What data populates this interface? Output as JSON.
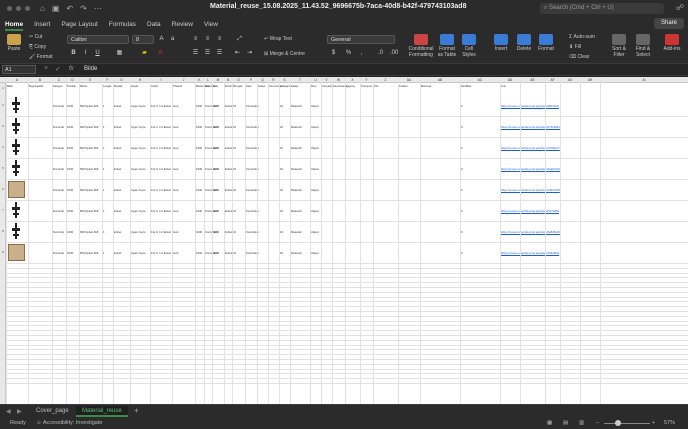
{
  "window": {
    "title": "Material_reuse_15.08.2025_11.43.52_9696675b-7aca-40d8-b42f-479743103ad8",
    "search_placeholder": "Search (Cmd + Ctrl + U)"
  },
  "tabs": [
    "Home",
    "Insert",
    "Page Layout",
    "Formulas",
    "Data",
    "Review",
    "View"
  ],
  "share_label": "Share",
  "ribbon": {
    "paste": "Paste",
    "cut": "Cut",
    "copy": "Copy",
    "format": "Format",
    "font_name": "Calibri",
    "font_size": "8",
    "wrap_text": "Wrap Text",
    "merge_centre": "Merge & Centre",
    "number_format": "General",
    "conditional_formatting": "Conditional Formatting",
    "format_as_table": "Format as Table",
    "cell_styles": "Cell Styles",
    "insert": "Insert",
    "delete": "Delete",
    "format_cells": "Format",
    "autosum": "Auto-sum",
    "fill": "Fill",
    "clear": "Clear",
    "sort_filter": "Sort & Filter",
    "find_select": "Find & Select",
    "add_ins": "Add-ins"
  },
  "formula_bar": {
    "cell_ref": "A1",
    "fx": "fx",
    "value": "Bilde"
  },
  "columns": [
    "A",
    "B",
    "C",
    "D",
    "E",
    "F",
    "G",
    "H",
    "I",
    "J",
    "K",
    "L",
    "M",
    "N",
    "O",
    "P",
    "Q",
    "R",
    "S",
    "T",
    "U",
    "V",
    "W",
    "X",
    "Y",
    "Z",
    "AA",
    "AB",
    "AC",
    "AD",
    "AE",
    "AF",
    "AG",
    "AH",
    "AI"
  ],
  "headers": [
    "Bilde",
    "Bygningsdel",
    "Kategori",
    "Produkt",
    "Merke",
    "Lengde",
    "Bredde",
    "Hoyde",
    "Antall",
    "Tilstand",
    "Beskrivelse",
    "Materiale",
    "Vekt",
    "Enhet",
    "Mengde",
    "Dato",
    "Status",
    "Kommentar",
    "Lokasjon",
    "Etasje",
    "Rom",
    "Ansvarlig",
    "Demontering",
    "Lagring",
    "Transport",
    "Pris",
    "Kvalitet",
    "Merknad",
    "Sertifikat",
    "Link"
  ],
  "rows": [
    {
      "num": "2",
      "has_part": true,
      "cells": [
        "",
        "",
        "Dorvindu",
        "1000",
        "MM Spleis 8x8",
        "1",
        "Enhet",
        "Ingen hoyre",
        "Fra 0, 1.0 Enkel",
        "God",
        "1000",
        "Kontrollert",
        "1000",
        "Enhet",
        "10",
        "Kontrollert",
        "",
        "",
        "10",
        "Materiell",
        "Ukjent",
        "",
        "",
        "",
        "",
        "",
        "",
        "",
        "0",
        "https://reuse-materials-prod.app/item/a8b3f1c0"
      ]
    },
    {
      "num": "3",
      "has_part": true,
      "cells": [
        "",
        "",
        "Dorvindu",
        "1000",
        "MM Spleis 8x8",
        "1",
        "Enhet",
        "Ingen hoyre",
        "Fra 0, 1.0 Enkel",
        "God",
        "1000",
        "Kontrollert",
        "1000",
        "Enhet",
        "10",
        "Kontrollert",
        "",
        "",
        "10",
        "Materiell",
        "Ukjent",
        "",
        "",
        "",
        "",
        "",
        "",
        "",
        "0",
        "https://reuse-materials-prod.app/item/b72e9d41"
      ]
    },
    {
      "num": "4",
      "has_part": true,
      "cells": [
        "",
        "",
        "Dorvindu",
        "1000",
        "MM Spleis 8x8",
        "1",
        "Enhet",
        "Ingen hoyre",
        "Fra 0, 1.0 Enkel",
        "God",
        "1000",
        "Kontrollert",
        "1000",
        "Enhet",
        "10",
        "Kontrollert",
        "",
        "",
        "10",
        "Materiell",
        "Ukjent",
        "",
        "",
        "",
        "",
        "",
        "",
        "",
        "0",
        "https://reuse-materials-prod.app/item/c15d0a77"
      ]
    },
    {
      "num": "5",
      "has_part": true,
      "cells": [
        "",
        "",
        "Dorvindu",
        "1000",
        "MM Spleis 8x8",
        "1",
        "Enhet",
        "Ingen hoyre",
        "Fra 0, 1.0 Enkel",
        "God",
        "1000",
        "Kontrollert",
        "1000",
        "Enhet",
        "10",
        "Kontrollert",
        "",
        "",
        "10",
        "Materiell",
        "Ukjent",
        "",
        "",
        "",
        "",
        "",
        "",
        "",
        "0",
        "https://reuse-materials-prod.app/item/d4a6e219"
      ]
    },
    {
      "num": "6",
      "has_part": false,
      "cells": [
        "",
        "",
        "Dorvindu",
        "1000",
        "MM Spleis 8x8",
        "1",
        "Enhet",
        "Ingen hoyre",
        "Fra 0, 1.0 Enkel",
        "God",
        "1000",
        "Kontrollert",
        "1000",
        "Enhet",
        "10",
        "Kontrollert",
        "",
        "",
        "10",
        "Materiell",
        "Ukjent",
        "",
        "",
        "",
        "",
        "",
        "",
        "",
        "0",
        "https://reuse-materials-prod.app/item/e90b3c58"
      ]
    },
    {
      "num": "7",
      "has_part": true,
      "cells": [
        "",
        "",
        "Dorvindu",
        "1000",
        "MM Spleis 8x8",
        "1",
        "Enhet",
        "Ingen hoyre",
        "Fra 0, 1.0 Enkel",
        "God",
        "1000",
        "Kontrollert",
        "1000",
        "Enhet",
        "10",
        "Kontrollert",
        "",
        "",
        "10",
        "Materiell",
        "Ukjent",
        "",
        "",
        "",
        "",
        "",
        "",
        "",
        "0",
        "https://reuse-materials-prod.app/item/f3c7a864"
      ]
    },
    {
      "num": "8",
      "has_part": true,
      "cells": [
        "",
        "",
        "Dorvindu",
        "1000",
        "MM Spleis 8x8",
        "1",
        "Enhet",
        "Ingen hoyre",
        "Fra 0, 1.0 Enkel",
        "God",
        "1000",
        "Kontrollert",
        "1000",
        "Enhet",
        "10",
        "Kontrollert",
        "",
        "",
        "10",
        "Materiell",
        "Ukjent",
        "",
        "",
        "",
        "",
        "",
        "",
        "",
        "0",
        "https://reuse-materials-prod.app/item/0a8d5e92"
      ]
    },
    {
      "num": "9",
      "has_part": false,
      "cells": [
        "",
        "",
        "Dorvindu",
        "1000",
        "MM Spleis 8x8",
        "1",
        "Enhet",
        "Ingen hoyre",
        "Fra 0, 1.0 Enkel",
        "God",
        "1000",
        "Kontrollert",
        "1000",
        "Enhet",
        "10",
        "Kontrollert",
        "",
        "",
        "10",
        "Materiell",
        "Ukjent",
        "",
        "",
        "",
        "",
        "",
        "",
        "",
        "0",
        "https://reuse-materials-prod.app/item/1b9e6fa3"
      ]
    }
  ],
  "sheets": [
    "Cover_page",
    "Material_reuse"
  ],
  "status": {
    "ready": "Ready",
    "accessibility": "Accessibility: Investigate",
    "zoom": "57%"
  }
}
